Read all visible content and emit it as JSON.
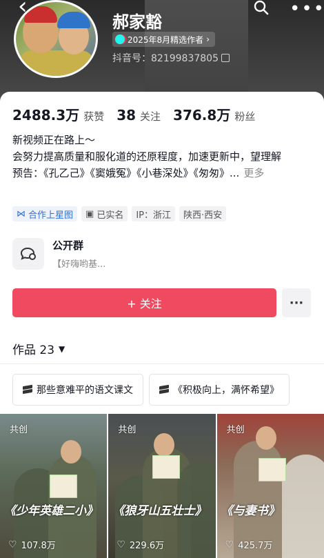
{
  "header": {
    "name": "郝家豁",
    "badge": "2025年8月精选作者",
    "account_id": "抖音号：82199837805"
  },
  "stats": [
    {
      "value": "2488.3万",
      "label": "获赞"
    },
    {
      "value": "38",
      "label": "关注"
    },
    {
      "value": "376.8万",
      "label": "粉丝"
    }
  ],
  "bio": {
    "line1": "新视频正在路上～",
    "line2": "会努力提高质量和服化道的还原程度，加速更新中，望理解",
    "line3": "预告：《孔乙己》《窦娥冤》《小巷深处》《匆匆》...",
    "more": "更多"
  },
  "tags": [
    "合作上星图",
    "已实名",
    "IP：浙江",
    "陕西·西安"
  ],
  "group": {
    "title": "公开群",
    "subtitle": "【好嗨哟基..."
  },
  "follow_button": "+ 关注",
  "works": {
    "label": "作品 23"
  },
  "collections": [
    "那些意难平的语文课文",
    "《积极向上，满怀希望》"
  ],
  "videos": [
    {
      "tag": "共创",
      "title": "《少年英雄二小》",
      "likes": "107.8万"
    },
    {
      "tag": "共创",
      "title": "《狼牙山五壮士》",
      "likes": "229.6万"
    },
    {
      "tag": "共创",
      "title": "《与妻书》",
      "likes": "425.7万"
    }
  ],
  "colors": {
    "accent": "#ef4a5f",
    "link": "#2f6fd6"
  }
}
